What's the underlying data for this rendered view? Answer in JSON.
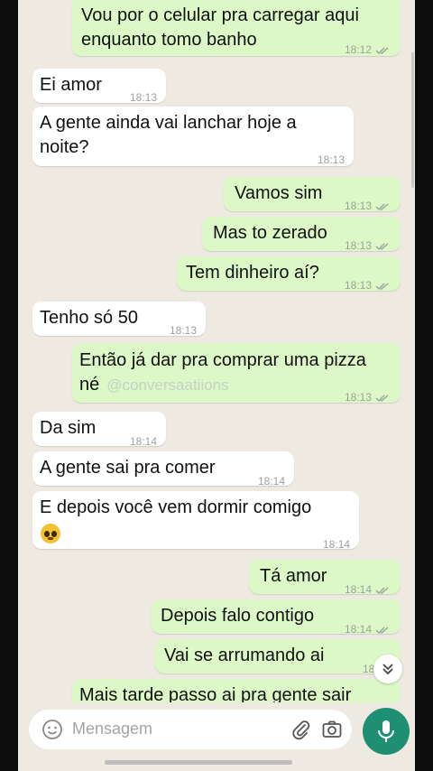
{
  "chat": {
    "messages": [
      {
        "dir": "out",
        "text": [
          "Vou por o celular pra carregar aqui",
          "enquanto tomo banho"
        ],
        "time": "18:12"
      },
      {
        "dir": "in",
        "text": [
          "Ei amor"
        ],
        "time": "18:13"
      },
      {
        "dir": "in",
        "text": [
          "A gente ainda vai lanchar hoje a",
          "noite?"
        ],
        "time": "18:13"
      },
      {
        "dir": "out",
        "text": [
          "Vamos sim"
        ],
        "time": "18:13"
      },
      {
        "dir": "out",
        "text": [
          "Mas to zerado"
        ],
        "time": "18:13"
      },
      {
        "dir": "out",
        "text": [
          "Tem dinheiro aí?"
        ],
        "time": "18:13"
      },
      {
        "dir": "in",
        "text": [
          "Tenho só 50"
        ],
        "time": "18:13"
      },
      {
        "dir": "out",
        "text": [
          "Então já dar pra comprar uma pizza",
          "né"
        ],
        "watermark": "@conversaatiions",
        "time": "18:13"
      },
      {
        "dir": "in",
        "text": [
          "Da sim"
        ],
        "time": "18:14"
      },
      {
        "dir": "in",
        "text": [
          "A gente sai pra comer"
        ],
        "time": "18:14"
      },
      {
        "dir": "in",
        "text": [
          "E depois você vem dormir comigo"
        ],
        "emoji": "pleading-face-emoji",
        "time": "18:14"
      },
      {
        "dir": "out",
        "text": [
          "Tá amor"
        ],
        "time": "18:14"
      },
      {
        "dir": "out",
        "text": [
          "Depois falo contigo"
        ],
        "time": "18:14"
      },
      {
        "dir": "out",
        "text": [
          "Vai se arrumando ai"
        ],
        "time": "18:14"
      },
      {
        "dir": "out",
        "text": [
          "Mais tarde passo ai pra gente sair"
        ],
        "time": ""
      }
    ]
  },
  "composer": {
    "placeholder": "Mensagem",
    "icons": [
      "emoji-icon",
      "attach-icon",
      "camera-icon",
      "mic-icon"
    ]
  },
  "colors": {
    "outgoing_bubble": "#dcf8c6",
    "incoming_bubble": "#ffffff",
    "chat_background": "#eeeae2",
    "mic_button": "#1f8f74",
    "read_ticks": "#9aa39a"
  }
}
